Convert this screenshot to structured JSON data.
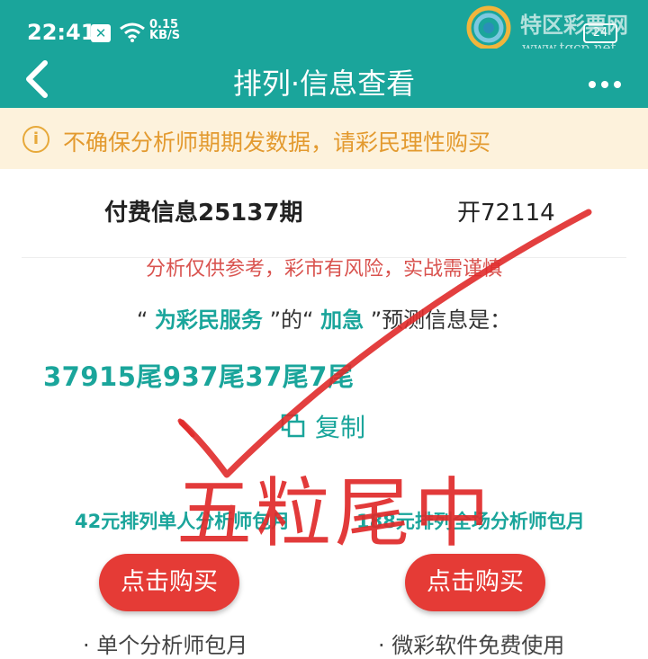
{
  "status_bar": {
    "time": "22:41",
    "notification_badge": "✕",
    "net_speed_value": "0.15",
    "net_speed_unit": "KB/S",
    "battery": "24"
  },
  "watermark": {
    "site_name": "特区彩票网",
    "url": "www.tqcp.net"
  },
  "nav": {
    "title": "排列·信息查看",
    "back_icon": "chevron-left-icon",
    "more_icon": "more-dots-icon"
  },
  "notice": {
    "icon": "info-circle-icon",
    "text": "不确保分析师期期发数据，请彩民理性购买"
  },
  "info": {
    "title": "付费信息25137期",
    "result": "开72114",
    "risk_warning": "分析仅供参考，彩市有风险，实战需谨慎",
    "prediction": {
      "quote_open_1": "“",
      "author": "为彩民服务",
      "quote_close_1": "”的“",
      "type": "加急",
      "quote_close_2": "”预测信息是："
    },
    "numbers": "37915尾937尾37尾7尾",
    "copy_label": "复制"
  },
  "plans": [
    {
      "label": "42元排列单人分析师包月",
      "button": "点击购买",
      "note": "单个分析师包月"
    },
    {
      "label": "188元排列全场分析师包月",
      "button": "点击购买",
      "note": "微彩软件免费使用"
    }
  ],
  "overlay": {
    "stamp_text": "五粒尾中"
  },
  "colors": {
    "primary": "#1aa59b",
    "notice_bg": "#fdf2dc",
    "notice_text": "#e39a2f",
    "warning_red": "#d9534f",
    "button_red": "#e53b36",
    "overlay_red": "#e02a2a"
  }
}
